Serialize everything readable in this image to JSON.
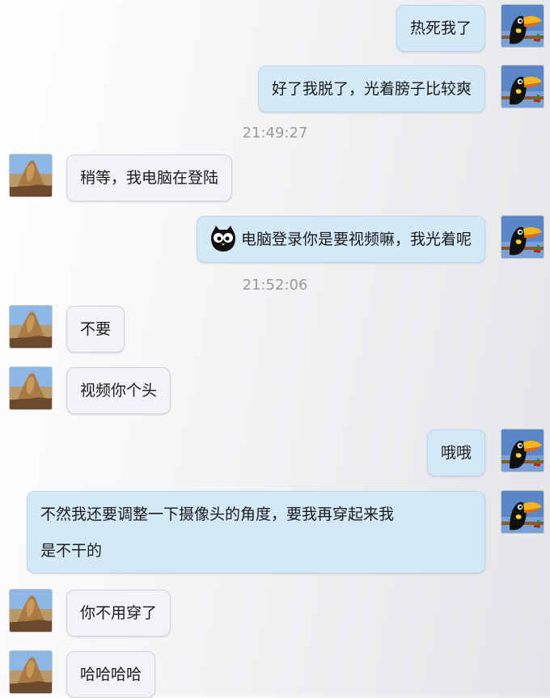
{
  "messages": [
    {
      "sender": "me",
      "text": "热死我了"
    },
    {
      "sender": "me",
      "text": "好了我脱了，光着膀子比较爽"
    },
    {
      "timestamp": "21:49:27"
    },
    {
      "sender": "friend",
      "text": "稍等，我电脑在登陆"
    },
    {
      "sender": "me",
      "emoji": "owl-emoji-icon",
      "text": "电脑登录你是要视频嘛，我光着呢"
    },
    {
      "timestamp": "21:52:06"
    },
    {
      "sender": "friend",
      "text": "不要"
    },
    {
      "sender": "friend",
      "text": "视频你个头"
    },
    {
      "sender": "me",
      "text": "哦哦"
    },
    {
      "sender": "me",
      "text_line1": "不然我还要调整一下摄像头的角度，要我再穿起来我",
      "text_line2": "是不干的"
    },
    {
      "sender": "friend",
      "text": "你不用穿了"
    },
    {
      "sender": "friend",
      "text": "哈哈哈哈"
    }
  ],
  "avatars": {
    "me": "toucan-bird-avatar",
    "friend": "rock-mountain-avatar"
  }
}
